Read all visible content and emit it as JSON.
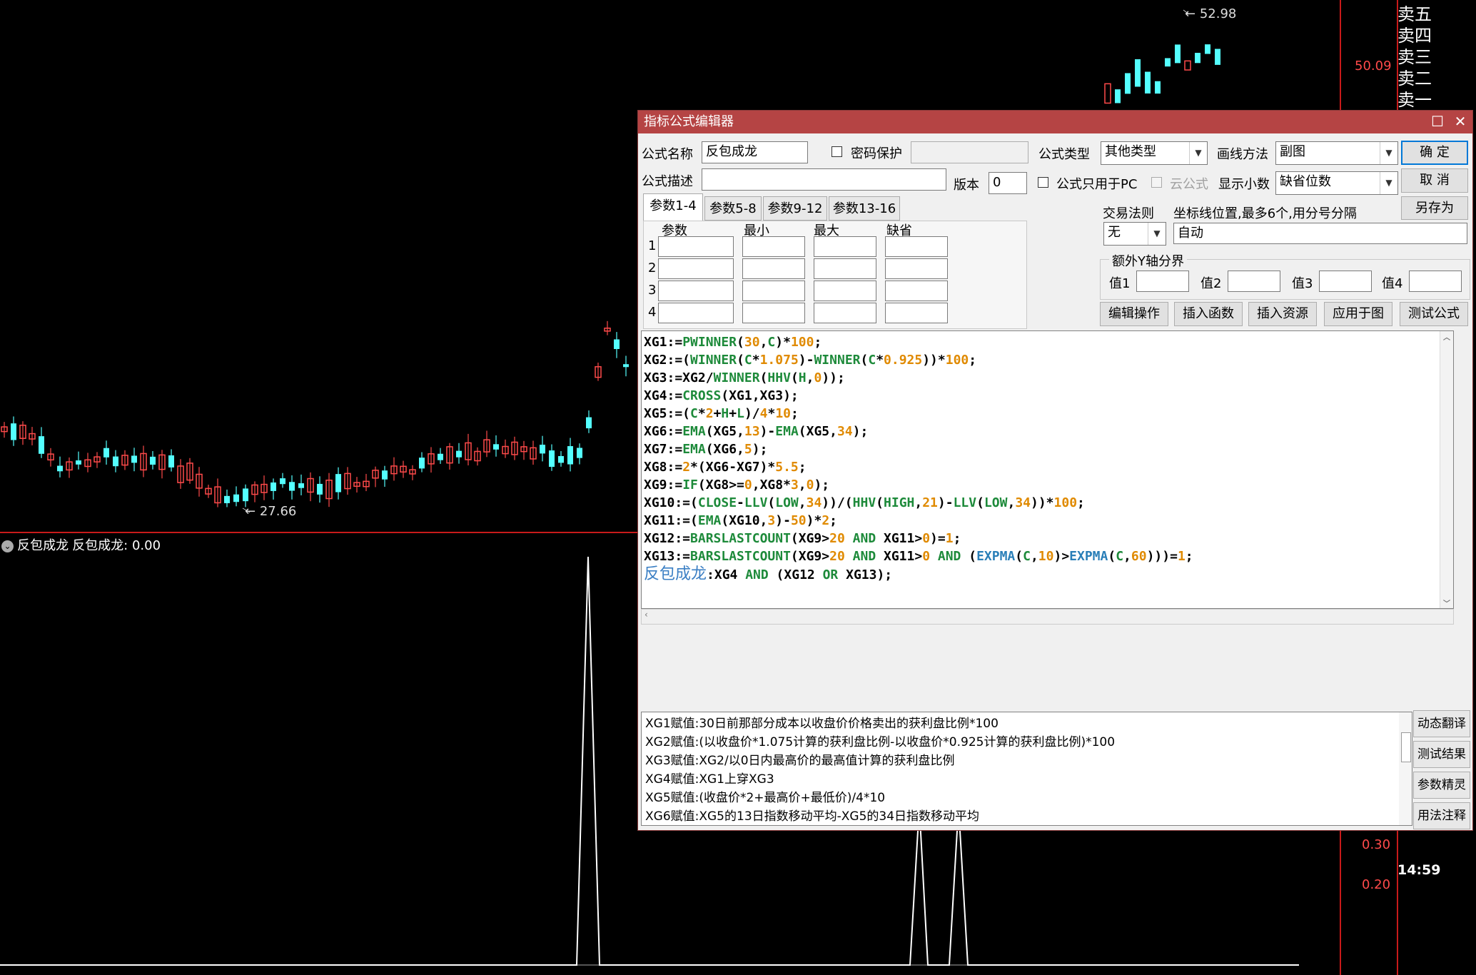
{
  "chart": {
    "indicator_name": "反包成龙",
    "indicator_value_label": "反包成龙: 0.00",
    "price_high": "52.98",
    "price_low": "27.66",
    "axis_price": "50.09",
    "sub_axis_values": [
      "0.30",
      "0.20"
    ],
    "time": "14:59",
    "order_book": [
      "卖五",
      "卖四",
      "卖三",
      "卖二",
      "卖一"
    ],
    "colors": {
      "up": "#ff4a4a",
      "down": "#54ffff",
      "axis": "#c81a1a",
      "line": "#ffffff"
    }
  },
  "dialog": {
    "title": "指标公式编辑器",
    "name_label": "公式名称",
    "name_value": "反包成龙",
    "password_label": "密码保护",
    "type_label": "公式类型",
    "type_value": "其他类型",
    "draw_label": "画线方法",
    "draw_value": "副图",
    "ok": "确  定",
    "cancel": "取  消",
    "save_as": "另存为",
    "desc_label": "公式描述",
    "version_label": "版本",
    "version_value": "0",
    "pc_only_label": "公式只用于PC",
    "cloud_label": "云公式",
    "decimals_label": "显示小数",
    "decimals_value": "缺省位数",
    "tabs": [
      "参数1-4",
      "参数5-8",
      "参数9-12",
      "参数13-16"
    ],
    "param_headers": [
      "参数",
      "最小",
      "最大",
      "缺省"
    ],
    "param_rows": [
      "1",
      "2",
      "3",
      "4"
    ],
    "trade_rule_label": "交易法则",
    "trade_rule_value": "无",
    "axis_pos_label": "坐标线位置,最多6个,用分号分隔",
    "axis_pos_value": "自动",
    "extra_y_label": "额外Y轴分界",
    "value_labels": [
      "值1",
      "值2",
      "值3",
      "值4"
    ],
    "action_buttons": [
      "编辑操作",
      "插入函数",
      "插入资源",
      "应用于图",
      "测试公式"
    ],
    "code_lines": [
      "XG1:=PWINNER(30,C)*100;",
      "XG2:=(WINNER(C*1.075)-WINNER(C*0.925))*100;",
      "XG3:=XG2/WINNER(HHV(H,0));",
      "XG4:=CROSS(XG1,XG3);",
      "XG5:=(C*2+H+L)/4*10;",
      "XG6:=EMA(XG5,13)-EMA(XG5,34);",
      "XG7:=EMA(XG6,5);",
      "XG8:=2*(XG6-XG7)*5.5;",
      "XG9:=IF(XG8>=0,XG8*3,0);",
      "XG10:=(CLOSE-LLV(LOW,34))/(HHV(HIGH,21)-LLV(LOW,34))*100;",
      "XG11:=(EMA(XG10,3)-50)*2;",
      "XG12:=BARSLASTCOUNT(XG9>20 AND XG11>0)=1;",
      "XG13:=BARSLASTCOUNT(XG9>20 AND XG11>0 AND (EXPMA(C,10)>EXPMA(C,60)))=1;",
      "反包成龙:XG4 AND (XG12 OR XG13);"
    ],
    "desc_lines": [
      "XG1赋值:30日前那部分成本以收盘价价格卖出的获利盘比例*100",
      "XG2赋值:(以收盘价*1.075计算的获利盘比例-以收盘价*0.925计算的获利盘比例)*100",
      "XG3赋值:XG2/以0日内最高价的最高值计算的获利盘比例",
      "XG4赋值:XG1上穿XG3",
      "XG5赋值:(收盘价*2+最高价+最低价)/4*10",
      "XG6赋值:XG5的13日指数移动平均-XG5的34日指数移动平均"
    ],
    "side_buttons": [
      "动态翻译",
      "测试结果",
      "参数精灵",
      "用法注释"
    ]
  }
}
